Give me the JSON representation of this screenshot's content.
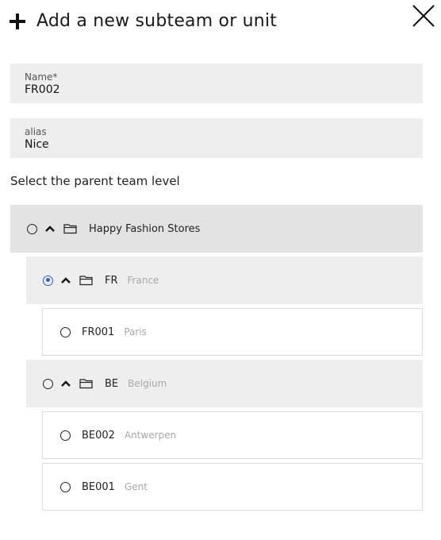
{
  "header": {
    "title": "Add a new subteam or unit",
    "plus_icon": "plus-icon",
    "close_icon": "close-icon"
  },
  "form": {
    "name_label": "Name*",
    "name_value": "FR002",
    "alias_label": "alias",
    "alias_value": "Nice"
  },
  "parent": {
    "label": "Select the parent team level",
    "tree": [
      {
        "code": "Happy Fashion Stores",
        "name": "",
        "level": 0,
        "selected": false,
        "expanded": true,
        "icon": "folder-icon"
      },
      {
        "code": "FR",
        "name": "France",
        "level": 1,
        "selected": true,
        "expanded": true,
        "icon": "folder-icon"
      },
      {
        "code": "FR001",
        "name": "Paris",
        "level": 2,
        "selected": false
      },
      {
        "code": "BE",
        "name": "Belgium",
        "level": 1,
        "selected": false,
        "expanded": true,
        "icon": "folder-icon"
      },
      {
        "code": "BE002",
        "name": "Antwerpen",
        "level": 2,
        "selected": false
      },
      {
        "code": "BE001",
        "name": "Gent",
        "level": 2,
        "selected": false
      }
    ]
  },
  "colors": {
    "selected_radio": "#2f62c5",
    "field_bg": "#eeeeee",
    "root_row_bg": "#e3e3e3"
  }
}
